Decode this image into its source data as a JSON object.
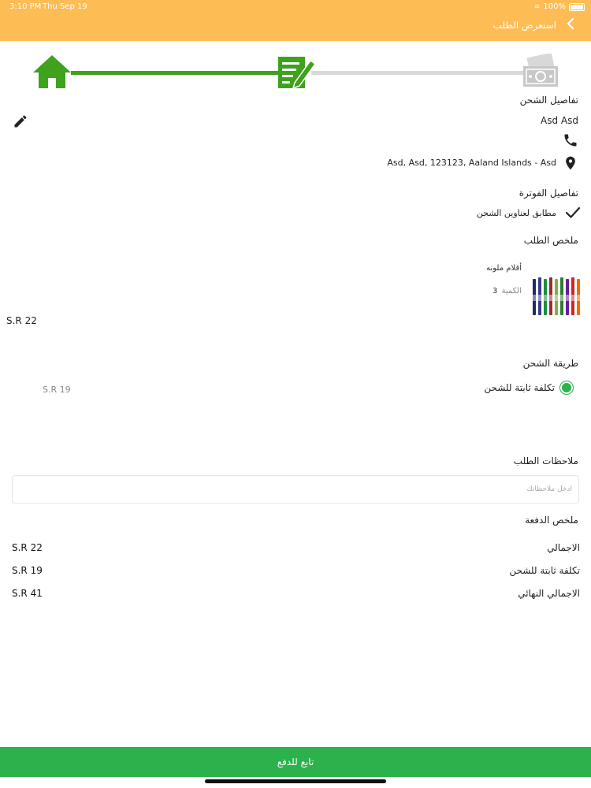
{
  "status_bar": {
    "time": "3:10 PM",
    "date": "Thu Sep 19",
    "battery": "100%"
  },
  "header": {
    "title": "استعرض الطلب"
  },
  "shipping_details": {
    "title": "تفاصيل الشحن",
    "name": "Asd Asd",
    "address": "Asd, Asd, 123123, Aaland Islands - Asd"
  },
  "billing_details": {
    "title": "تفاصيل الفوترة",
    "same_as_shipping": "مطابق لعناوين الشحن"
  },
  "order_summary": {
    "title": "ملخص الطلب",
    "item": {
      "name": "أقلام ملونه",
      "qty_label": "الكمية",
      "qty": "3",
      "price": "S.R 22"
    }
  },
  "shipping_method": {
    "title": "طريقة الشحن",
    "option_label": "تكلفة ثابتة للشحن",
    "option_price": "S.R 19"
  },
  "order_notes": {
    "title": "ملاحظات الطلب",
    "placeholder": "ادخل ملاحظاتك"
  },
  "payment_summary": {
    "title": "ملخص الدفعة",
    "rows": [
      {
        "label": "الاجمالي",
        "value": "S.R 22"
      },
      {
        "label": "تكلفة ثابتة للشحن",
        "value": "S.R 19"
      },
      {
        "label": "الاجمالي النهائي",
        "value": "S.R 41"
      }
    ]
  },
  "continue_button": {
    "label": "تابع للدفع"
  },
  "colors": {
    "header": "#FDBC54",
    "green": "#3FA21D",
    "button": "#2BB24C",
    "gray_line": "#DADADA"
  },
  "icons": [
    "chevron-left-icon",
    "home-icon",
    "form-edit-icon",
    "money-icon",
    "edit-pencil-icon",
    "phone-icon",
    "location-pin-icon",
    "check-icon",
    "radio-icon"
  ]
}
